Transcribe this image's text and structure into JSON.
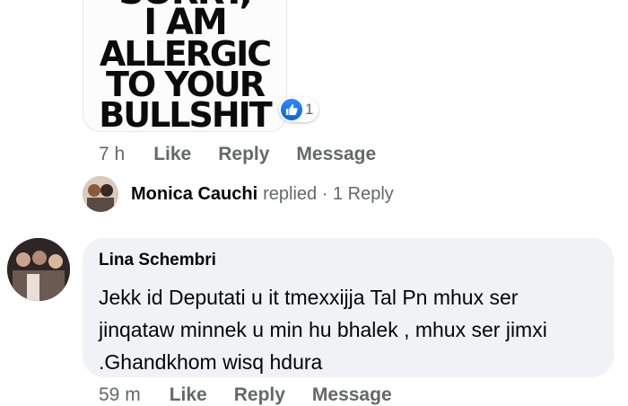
{
  "sticker": {
    "lines": [
      "SORRY,",
      "I AM",
      "ALLERGIC",
      "TO YOUR",
      "BULLSHIT"
    ]
  },
  "reaction": {
    "icon": "thumbs-up-icon",
    "count": "1",
    "color": "#1877f2"
  },
  "first_comment": {
    "time": "7 h",
    "like_label": "Like",
    "reply_label": "Reply",
    "message_label": "Message"
  },
  "replied": {
    "name": "Monica Cauchi",
    "text": "replied · 1 Reply"
  },
  "comment": {
    "author": "Lina Schembri",
    "text": "Jekk id Deputati u it tmexxijja Tal Pn mhux ser jinqataw minnek u min hu bhalek , mhux ser jimxi .Ghandkhom wisq hdura",
    "time": "59 m",
    "like_label": "Like",
    "reply_label": "Reply",
    "message_label": "Message"
  }
}
